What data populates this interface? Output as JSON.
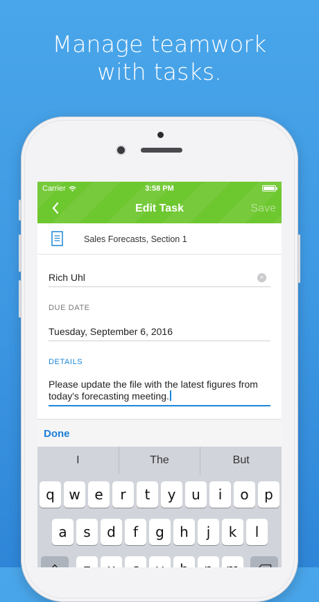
{
  "headline": {
    "line1": "Manage teamwork",
    "line2": "with tasks."
  },
  "status_bar": {
    "carrier": "Carrier",
    "time": "3:58 PM"
  },
  "navbar": {
    "back_icon": "chevron-left-icon",
    "title": "Edit Task",
    "save_label": "Save"
  },
  "attachment": {
    "icon": "document-icon",
    "name": "Sales Forecasts, Section 1"
  },
  "form": {
    "assignee_value": "Rich Uhl",
    "due_date_label": "DUE DATE",
    "due_date_value": "Tuesday, September 6, 2016",
    "details_label": "DETAILS",
    "details_value": "Please update the file with the latest figures from today's forecasting meeting."
  },
  "toolbar": {
    "done_label": "Done"
  },
  "keyboard": {
    "suggestions": [
      "I",
      "The",
      "But"
    ],
    "row1": [
      "q",
      "w",
      "e",
      "r",
      "t",
      "y",
      "u",
      "i",
      "o",
      "p"
    ],
    "row2": [
      "a",
      "s",
      "d",
      "f",
      "g",
      "h",
      "j",
      "k",
      "l"
    ],
    "row3": [
      "z",
      "x",
      "c",
      "v",
      "b",
      "n",
      "m"
    ],
    "shift_icon": "shift-icon",
    "delete_icon": "backspace-icon"
  },
  "colors": {
    "background": "#4aa6ea",
    "navbar": "#6dc72f",
    "accent": "#1a86d6"
  }
}
